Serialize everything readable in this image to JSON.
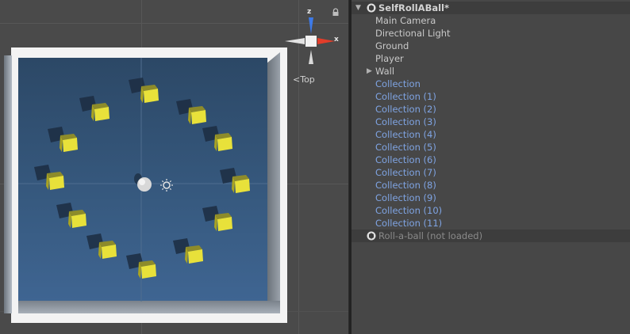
{
  "scene_view": {
    "view_mode": "Top",
    "gizmo": {
      "z_axis": "z",
      "x_axis": "x"
    }
  },
  "hierarchy": {
    "scene_name": "SelfRollABall*",
    "items": [
      {
        "label": "Main Camera",
        "kind": "normal",
        "indent": 1,
        "foldout": false
      },
      {
        "label": "Directional Light",
        "kind": "normal",
        "indent": 1,
        "foldout": false
      },
      {
        "label": "Ground",
        "kind": "normal",
        "indent": 1,
        "foldout": false
      },
      {
        "label": "Player",
        "kind": "normal",
        "indent": 1,
        "foldout": false
      },
      {
        "label": "Wall",
        "kind": "normal",
        "indent": 1,
        "foldout": true
      },
      {
        "label": "Collection",
        "kind": "prefab",
        "indent": 1,
        "foldout": false
      },
      {
        "label": "Collection (1)",
        "kind": "prefab",
        "indent": 1,
        "foldout": false
      },
      {
        "label": "Collection (2)",
        "kind": "prefab",
        "indent": 1,
        "foldout": false
      },
      {
        "label": "Collection (3)",
        "kind": "prefab",
        "indent": 1,
        "foldout": false
      },
      {
        "label": "Collection (4)",
        "kind": "prefab",
        "indent": 1,
        "foldout": false
      },
      {
        "label": "Collection (5)",
        "kind": "prefab",
        "indent": 1,
        "foldout": false
      },
      {
        "label": "Collection (6)",
        "kind": "prefab",
        "indent": 1,
        "foldout": false
      },
      {
        "label": "Collection (7)",
        "kind": "prefab",
        "indent": 1,
        "foldout": false
      },
      {
        "label": "Collection (8)",
        "kind": "prefab",
        "indent": 1,
        "foldout": false
      },
      {
        "label": "Collection (9)",
        "kind": "prefab",
        "indent": 1,
        "foldout": false
      },
      {
        "label": "Collection (10)",
        "kind": "prefab",
        "indent": 1,
        "foldout": false
      },
      {
        "label": "Collection (11)",
        "kind": "prefab",
        "indent": 1,
        "foldout": false
      }
    ],
    "unloaded_scene": "Roll-a-ball (not loaded)"
  },
  "colors": {
    "prefab_text": "#7fa4e3",
    "normal_text": "#c9c9c9",
    "pickup_yellow": "#e8e13a",
    "ground_blue": "#375a80"
  },
  "icons": {
    "scene": "unity-scene-icon",
    "lock": "lock-icon",
    "light": "sun-icon",
    "foldout": "triangle-right-icon"
  }
}
